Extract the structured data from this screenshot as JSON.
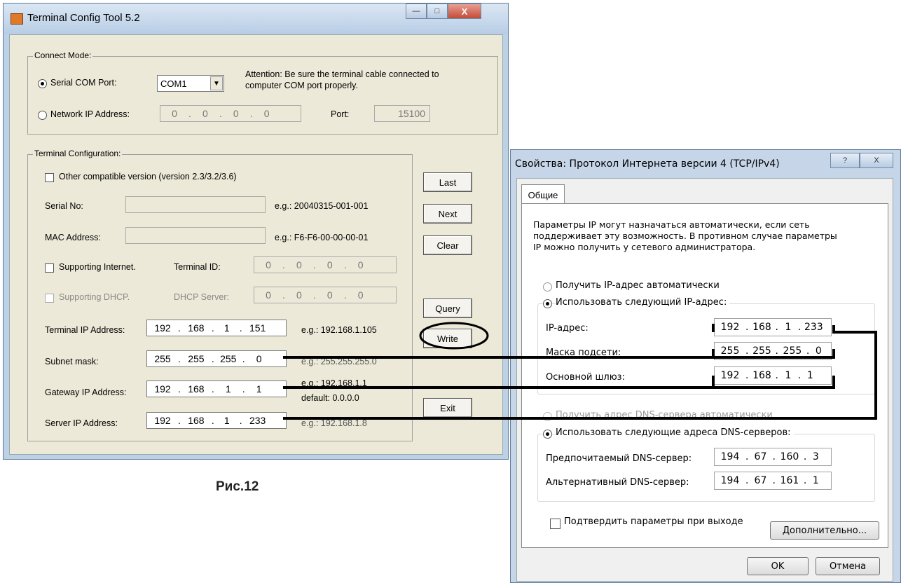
{
  "caption": "Рис.12",
  "left": {
    "title": "Terminal Config Tool 5.2",
    "connect_mode": {
      "legend": "Connect Mode:",
      "serial_label": "Serial COM Port:",
      "com_value": "COM1",
      "attention": "Attention: Be sure the terminal cable connected to",
      "attention2": "computer COM port properly.",
      "network_label": "Network IP Address:",
      "network_ip": [
        "0",
        "0",
        "0",
        "0"
      ],
      "port_label": "Port:",
      "port_value": "15100"
    },
    "terminal_config": {
      "legend": "Terminal Configuration:",
      "other_version": "Other compatible version (version 2.3/3.2/3.6)",
      "serial_no": "Serial No:",
      "serial_eg": "e.g.: 20040315-001-001",
      "mac": "MAC Address:",
      "mac_eg": "e.g.: F6-F6-00-00-00-01",
      "supporting_internet": "Supporting Internet.",
      "terminal_id": "Terminal ID:",
      "terminal_id_ip": [
        "0",
        "0",
        "0",
        "0"
      ],
      "supporting_dhcp": "Supporting DHCP.",
      "dhcp_server": "DHCP Server:",
      "dhcp_ip": [
        "0",
        "0",
        "0",
        "0"
      ],
      "terminal_ip_label": "Terminal IP Address:",
      "terminal_ip": [
        "192",
        "168",
        "1",
        "151"
      ],
      "terminal_ip_eg": "e.g.: 192.168.1.105",
      "subnet_label": "Subnet mask:",
      "subnet": [
        "255",
        "255",
        "255",
        "0"
      ],
      "subnet_eg": "e.g.: 255.255.255.0",
      "gateway_label": "Gateway IP Address:",
      "gateway": [
        "192",
        "168",
        "1",
        "1"
      ],
      "gateway_eg": "e.g.: 192.168.1.1",
      "gateway_default": "default: 0.0.0.0",
      "server_label": "Server IP Address:",
      "server": [
        "192",
        "168",
        "1",
        "233"
      ],
      "server_eg": "e.g.: 192.168.1.8"
    },
    "buttons": {
      "last": "Last",
      "next": "Next",
      "clear": "Clear",
      "query": "Query",
      "write": "Write",
      "exit": "Exit"
    }
  },
  "right": {
    "title": "Свойства: Протокол Интернета версии 4 (TCP/IPv4)",
    "help": "?",
    "close": "X",
    "tab": "Общие",
    "desc1": "Параметры IP могут назначаться автоматически, если сеть",
    "desc2": "поддерживает эту возможность. В противном случае параметры",
    "desc3": "IP можно получить у сетевого администратора.",
    "auto_ip": "Получить IP-адрес автоматически",
    "manual_ip": "Использовать следующий IP-адрес:",
    "ip_label": "IP-адрес:",
    "ip": [
      "192",
      "168",
      "1",
      "233"
    ],
    "mask_label": "Маска подсети:",
    "mask": [
      "255",
      "255",
      "255",
      "0"
    ],
    "gw_label": "Основной шлюз:",
    "gw": [
      "192",
      "168",
      "1",
      "1"
    ],
    "auto_dns": "Получить адрес DNS-сервера автоматически",
    "manual_dns": "Использовать следующие адреса DNS-серверов:",
    "pref_dns_label": "Предпочитаемый DNS-сервер:",
    "pref_dns": [
      "194",
      "67",
      "160",
      "3"
    ],
    "alt_dns_label": "Альтернативный DNS-сервер:",
    "alt_dns": [
      "194",
      "67",
      "161",
      "1"
    ],
    "confirm": "Подтвердить параметры при выходе",
    "advanced": "Дополнительно...",
    "ok": "OK",
    "cancel": "Отмена"
  }
}
